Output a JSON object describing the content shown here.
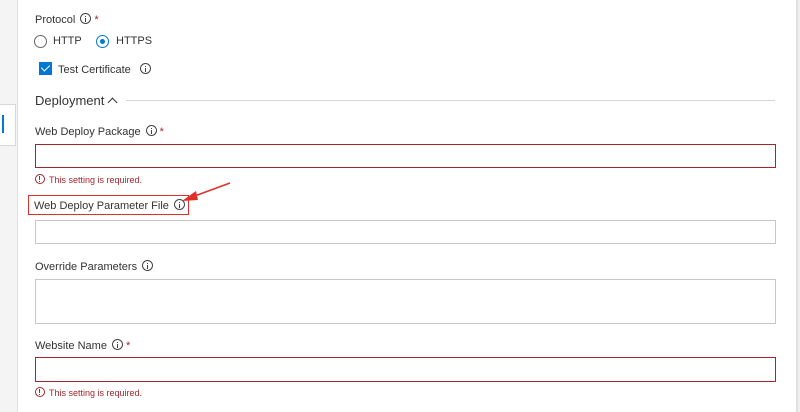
{
  "protocol": {
    "label": "Protocol",
    "required_mark": "*",
    "options": [
      {
        "label": "HTTP",
        "selected": false
      },
      {
        "label": "HTTPS",
        "selected": true
      }
    ],
    "test_certificate": {
      "label": "Test Certificate",
      "checked": true
    }
  },
  "deployment_section": {
    "title": "Deployment",
    "expanded": true
  },
  "fields": {
    "web_deploy_package": {
      "label": "Web Deploy Package",
      "required_mark": "*",
      "value": "",
      "error": "This setting is required."
    },
    "web_deploy_parameter_file": {
      "label": "Web Deploy Parameter File",
      "value": ""
    },
    "override_parameters": {
      "label": "Override Parameters",
      "value": ""
    },
    "website_name": {
      "label": "Website Name",
      "required_mark": "*",
      "value": "",
      "error": "This setting is required."
    }
  },
  "annotation": {
    "color": "#e0302a"
  },
  "colors": {
    "accent": "#0078d4",
    "error": "#a4262c"
  }
}
